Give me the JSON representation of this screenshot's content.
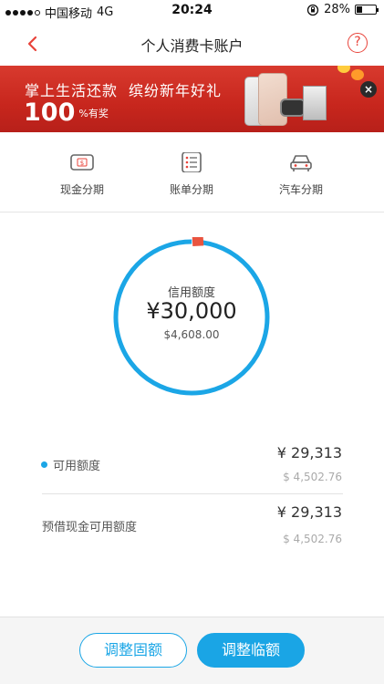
{
  "status_bar": {
    "carrier": "中国移动",
    "network": "4G",
    "time": "20:24",
    "battery_pct_label": "28%",
    "battery_level": 0.28
  },
  "nav": {
    "title": "个人消费卡账户",
    "help_glyph": "?"
  },
  "banner": {
    "text_a": "掌上生活还款",
    "text_b": "缤纷新年好礼",
    "pct_number": "100",
    "pct_suffix": "%有奖",
    "close_glyph": "×"
  },
  "categories": [
    {
      "label": "现金分期",
      "icon": "cash-card-icon",
      "glyph": "$"
    },
    {
      "label": "账单分期",
      "icon": "bill-list-icon"
    },
    {
      "label": "汽车分期",
      "icon": "car-icon"
    }
  ],
  "credit": {
    "label": "信用额度",
    "amount": "¥30,000",
    "usd": "$4,608.00",
    "used_fraction": 0.023
  },
  "rows": [
    {
      "label": "可用额度",
      "value": "¥ 29,313",
      "sub": "$ 4,502.76"
    },
    {
      "label": "预借现金可用额度",
      "value": "¥ 29,313",
      "sub": "$ 4,502.76"
    }
  ],
  "footer": {
    "fixed_button": "调整固额",
    "temp_button": "调整临额"
  },
  "colors": {
    "accent_blue": "#1ba6e6",
    "brand_red": "#e8433a",
    "used_segment": "#e9543f"
  }
}
